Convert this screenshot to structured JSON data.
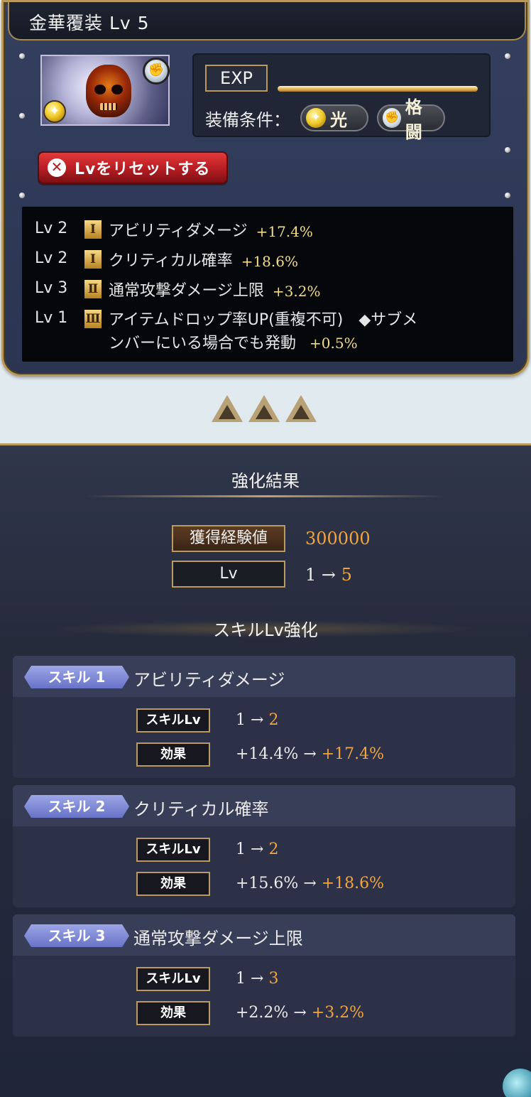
{
  "header": {
    "title": "金華覆装 Lv 5"
  },
  "item": {
    "icon": "skull-icon",
    "element_badge": "light-element-icon",
    "weapon_badge": "fist-icon"
  },
  "info": {
    "exp_label": "EXP",
    "exp_progress": 1.0,
    "condition_label": "装備条件：",
    "conditions": [
      {
        "icon": "light-element-icon",
        "label": "光"
      },
      {
        "icon": "fist-icon",
        "label": "格闘"
      }
    ]
  },
  "reset_button": {
    "label": "Lvをリセットする",
    "icon": "close-icon"
  },
  "skills_current": [
    {
      "level": "Lv 2",
      "rank": "Ⅰ",
      "name": "アビリティダメージ",
      "bonus": "+17.4%"
    },
    {
      "level": "Lv 2",
      "rank": "Ⅰ",
      "name": "クリティカル確率",
      "bonus": "+18.6%"
    },
    {
      "level": "Lv 3",
      "rank": "Ⅱ",
      "name": "通常攻撃ダメージ上限",
      "bonus": "+3.2%"
    },
    {
      "level": "Lv 1",
      "rank": "Ⅲ",
      "name_line1": "アイテムドロップ率UP(重複不可)　◆サブメ",
      "name_line2": "ンバーにいる場合でも発動",
      "bonus": "+0.5%"
    }
  ],
  "result": {
    "title": "強化結果",
    "exp_label": "獲得経験値",
    "exp_value": "300000",
    "lv_label": "Lv",
    "lv_from": "1 →",
    "lv_to": "5",
    "skill_section_title": "スキルLv強化"
  },
  "skill_cards": [
    {
      "tag": "スキル 1",
      "name": "アビリティダメージ",
      "lv_label": "スキルLv",
      "lv_from": "1 →",
      "lv_to": "2",
      "effect_label": "効果",
      "effect_from": "+14.4% →",
      "effect_to": "+17.4%"
    },
    {
      "tag": "スキル 2",
      "name": "クリティカル確率",
      "lv_label": "スキルLv",
      "lv_from": "1 →",
      "lv_to": "2",
      "effect_label": "効果",
      "effect_from": "+15.6% →",
      "effect_to": "+18.6%"
    },
    {
      "tag": "スキル 3",
      "name": "通常攻撃ダメージ上限",
      "lv_label": "スキルLv",
      "lv_from": "1 →",
      "lv_to": "3",
      "effect_label": "効果",
      "effect_from": "+2.2% →",
      "effect_to": "+3.2%"
    }
  ],
  "colors": {
    "accent_gold": "#b99a5c",
    "value_orange": "#f2a53c",
    "reset_red": "#c72226",
    "skill_tag": "#7b85d3"
  }
}
